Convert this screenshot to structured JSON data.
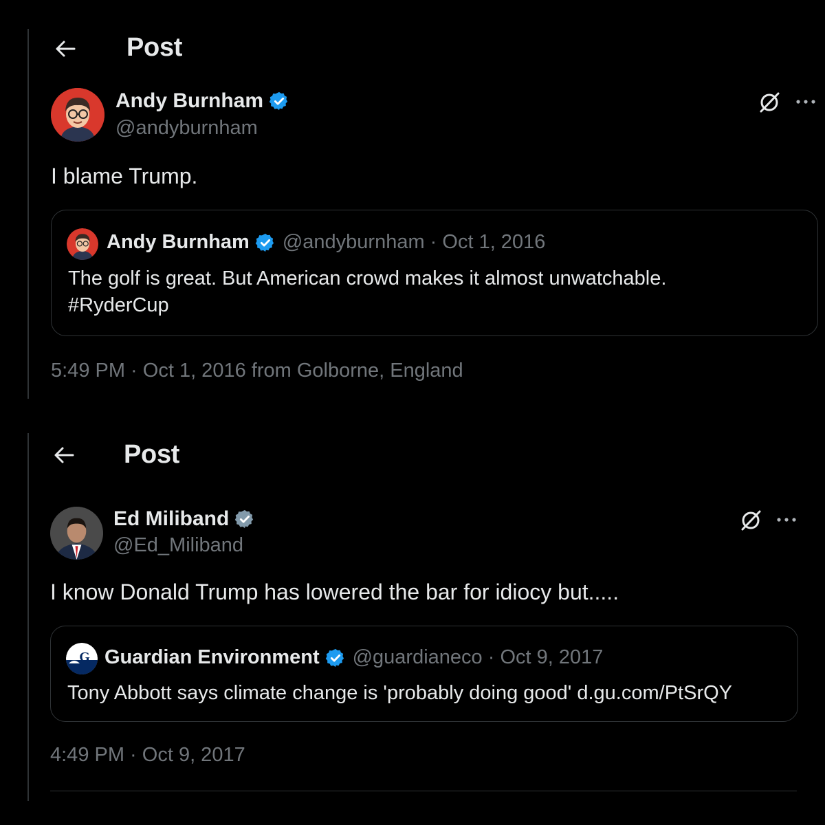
{
  "posts": [
    {
      "header_title": "Post",
      "author_name": "Andy Burnham",
      "author_handle": "@andyburnham",
      "text": "I blame Trump.",
      "quote": {
        "author_name": "Andy Burnham",
        "meta": "@andyburnham · Oct 1, 2016",
        "text_line1": "The golf is great. But American crowd makes it almost unwatchable.",
        "text_line2": "#RyderCup"
      },
      "timestamp": "5:49 PM · Oct 1, 2016 from Golborne, England"
    },
    {
      "header_title": "Post",
      "author_name": "Ed Miliband",
      "author_handle": "@Ed_Miliband",
      "text": "I know Donald Trump has lowered the bar for idiocy but.....",
      "quote": {
        "author_name": "Guardian Environment",
        "meta": "@guardianeco · Oct 9, 2017",
        "text_line1": "Tony Abbott says climate change is 'probably doing good' d.gu.com/PtSrQY"
      },
      "timestamp": "4:49 PM · Oct 9, 2017"
    }
  ],
  "colors": {
    "background": "#000000",
    "text": "#e7e9ea",
    "muted": "#71767b",
    "border": "#2f3336",
    "verified_blue": "#1d9bf0",
    "verified_gray": "#829aab"
  },
  "icons": [
    "back-arrow-icon",
    "verified-badge-icon",
    "grok-icon",
    "more-options-icon"
  ]
}
